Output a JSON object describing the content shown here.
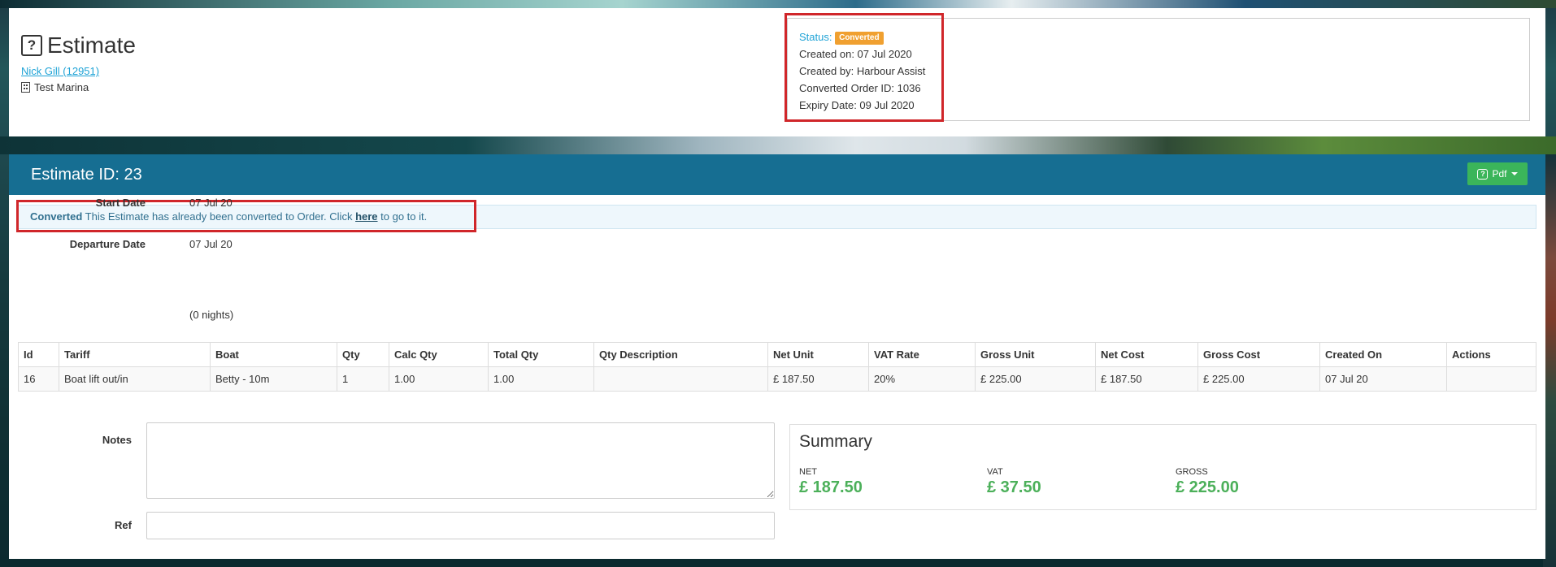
{
  "header": {
    "title": "Estimate",
    "customer_link": "Nick Gill (12951)",
    "marina": "Test Marina"
  },
  "status_box": {
    "status_label": "Status:",
    "status_badge": "Converted",
    "created_on": "Created on: 07 Jul 2020",
    "created_by": "Created by: Harbour Assist",
    "converted_order": "Converted Order ID: 1036",
    "expiry_date": "Expiry Date: 09 Jul 2020"
  },
  "main": {
    "estimate_id": "Estimate ID: 23",
    "pdf_button": "Pdf",
    "alert": {
      "strong": "Converted",
      "text_before": " This Estimate has already been converted to Order. Click ",
      "link": "here",
      "text_after": " to go to it."
    },
    "start_date_label": "Start Date",
    "start_date_value": "07 Jul 20",
    "departure_date_label": "Departure Date",
    "departure_date_value": "07 Jul 20",
    "nights": "(0 nights)"
  },
  "table": {
    "headers": [
      "Id",
      "Tariff",
      "Boat",
      "Qty",
      "Calc Qty",
      "Total Qty",
      "Qty Description",
      "Net Unit",
      "VAT Rate",
      "Gross Unit",
      "Net Cost",
      "Gross Cost",
      "Created On",
      "Actions"
    ],
    "rows": [
      [
        "16",
        "Boat lift out/in",
        "Betty - 10m",
        "1",
        "1.00",
        "1.00",
        "",
        "£ 187.50",
        "20%",
        "£ 225.00",
        "£ 187.50",
        "£ 225.00",
        "07 Jul 20",
        ""
      ]
    ]
  },
  "form": {
    "notes_label": "Notes",
    "notes_value": "",
    "ref_label": "Ref",
    "ref_value": ""
  },
  "summary": {
    "title": "Summary",
    "net_label": "NET",
    "net_value": "£ 187.50",
    "vat_label": "VAT",
    "vat_value": "£ 37.50",
    "gross_label": "GROSS",
    "gross_value": "£ 225.00"
  },
  "colors": {
    "header_bar": "#166e92",
    "link": "#1fa3d6",
    "badge": "#f0a030",
    "pdf_button": "#3bb55a",
    "summary_value": "#4cb05a",
    "highlight": "#d0262a"
  },
  "icons": {
    "title_icon": "question-square-icon",
    "marina_icon": "building-icon",
    "pdf_icon": "question-square-icon",
    "pdf_caret": "caret-down-icon"
  }
}
